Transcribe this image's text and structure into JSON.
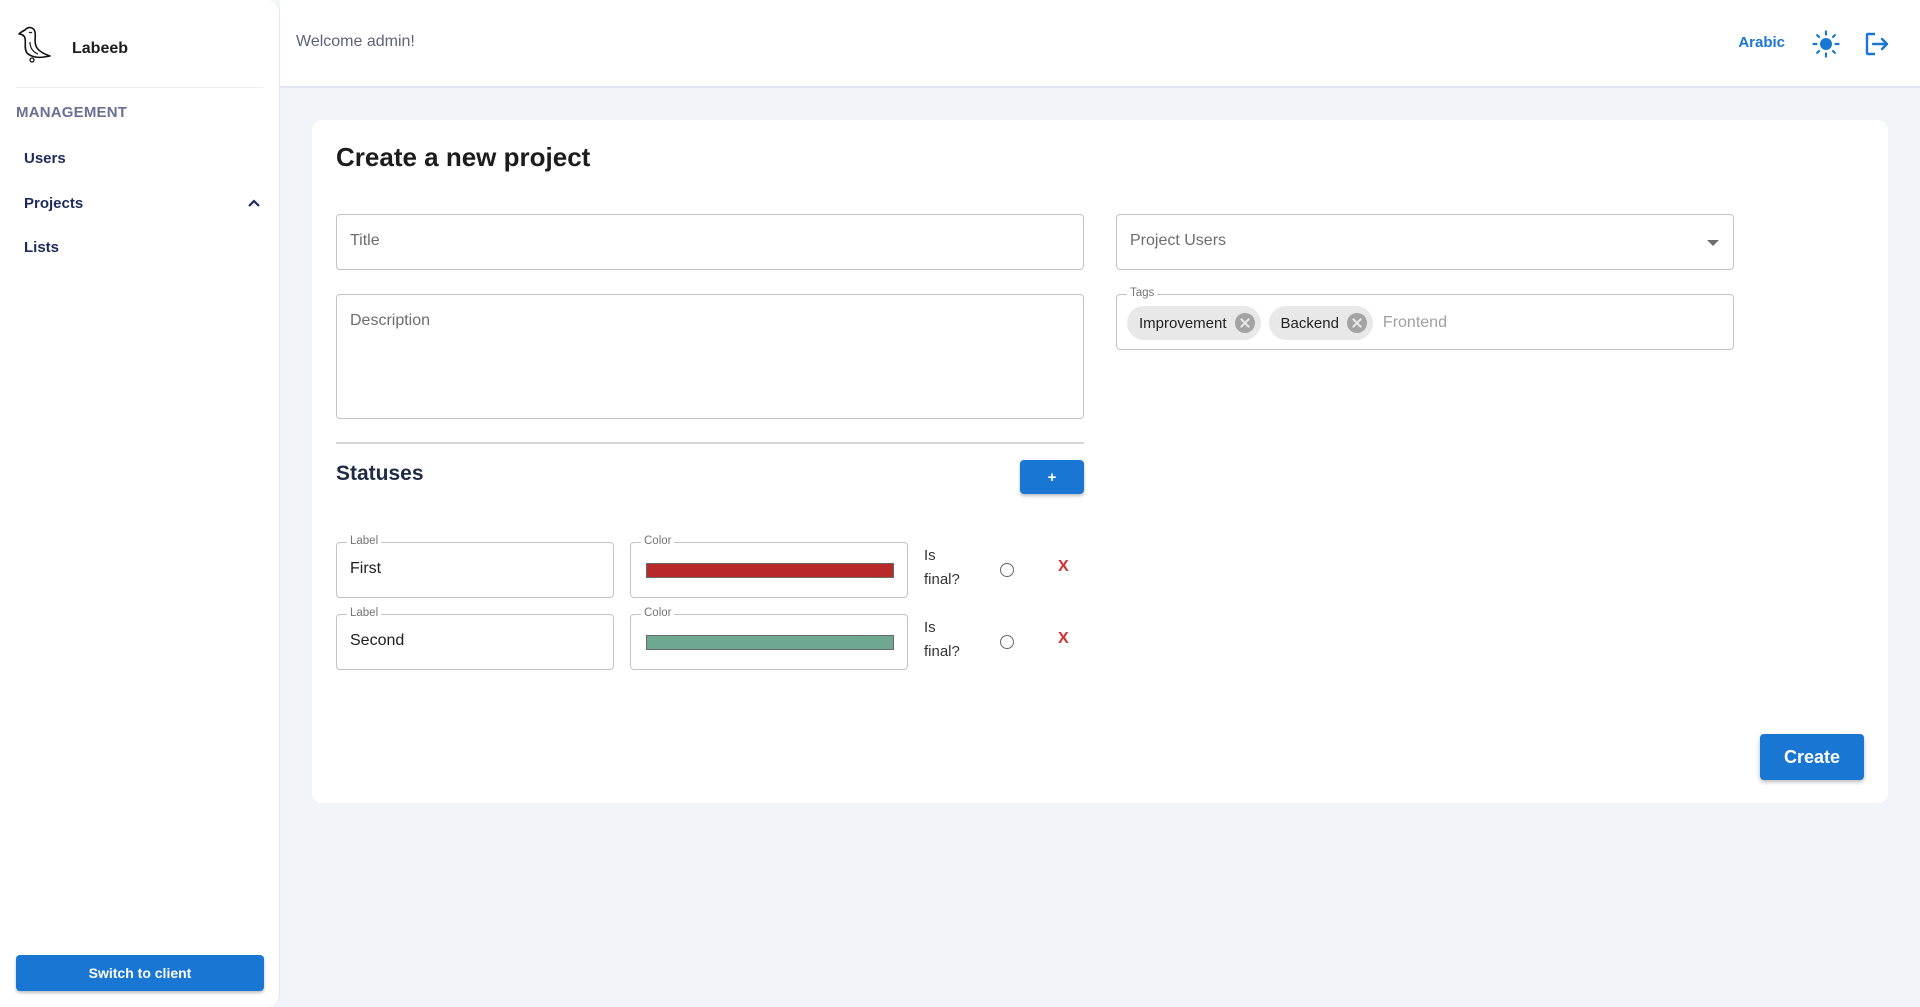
{
  "app": {
    "name": "Labeeb"
  },
  "sidebar": {
    "section_title": "MANAGEMENT",
    "items": [
      {
        "label": "Users"
      },
      {
        "label": "Projects",
        "expanded": true
      },
      {
        "label": "Lists"
      }
    ],
    "switch_button": "Switch to client"
  },
  "header": {
    "welcome": "Welcome admin!",
    "language_button": "Arabic",
    "theme_icon": "sun-icon",
    "logout_icon": "logout-icon"
  },
  "form": {
    "page_title": "Create a new project",
    "title_placeholder": "Title",
    "title_value": "",
    "description_placeholder": "Description",
    "description_value": "",
    "project_users_placeholder": "Project Users",
    "tags": {
      "legend": "Tags",
      "chips": [
        {
          "label": "Improvement"
        },
        {
          "label": "Backend"
        }
      ],
      "input_value": "",
      "input_placeholder": "Frontend"
    },
    "statuses": {
      "heading": "Statuses",
      "add_button": "+",
      "rows": [
        {
          "label_legend": "Label",
          "label_value": "First",
          "color_legend": "Color",
          "color": "#b82a2a",
          "is_final_label": "Is final?",
          "is_final": false,
          "delete_label": "X"
        },
        {
          "label_legend": "Label",
          "label_value": "Second",
          "color_legend": "Color",
          "color": "#6fa890",
          "is_final_label": "Is final?",
          "is_final": false,
          "delete_label": "X"
        }
      ]
    },
    "create_button": "Create"
  },
  "colors": {
    "primary": "#1976d2",
    "danger": "#d32f2f",
    "background": "#f1f4f9",
    "nav_text": "#1f2a5c",
    "section_text": "#6b6f93"
  }
}
